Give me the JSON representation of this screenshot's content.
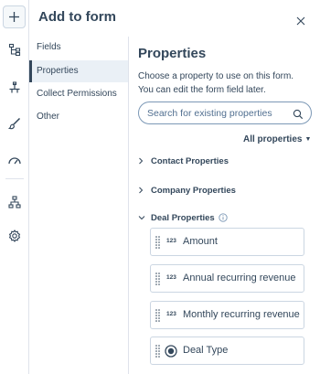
{
  "header": {
    "title": "Add to form"
  },
  "rail": {
    "icons": [
      "plus-icon",
      "tree-structure-icon",
      "adjust-icon",
      "brush-icon",
      "gauge-icon",
      "hierarchy-icon",
      "settings-icon"
    ]
  },
  "subnav": {
    "items": [
      {
        "label": "Fields",
        "active": false
      },
      {
        "label": "Properties",
        "active": true
      },
      {
        "label": "Collect Permissions",
        "active": false
      },
      {
        "label": "Other",
        "active": false
      }
    ]
  },
  "panel": {
    "title": "Properties",
    "description": "Choose a property to use on this form. You can edit the form field later.",
    "search_placeholder": "Search for existing properties",
    "filter_label": "All properties",
    "sections": [
      {
        "label": "Contact Properties",
        "expanded": false
      },
      {
        "label": "Company Properties",
        "expanded": false
      },
      {
        "label": "Deal Properties",
        "expanded": true
      }
    ],
    "properties": [
      {
        "type_badge": "123",
        "label": "Amount"
      },
      {
        "type_badge": "123",
        "label": "Annual recurring revenue"
      },
      {
        "type_badge": "123",
        "label": "Monthly recurring revenue"
      },
      {
        "type_badge": "radio",
        "label": "Deal Type"
      }
    ]
  },
  "colors": {
    "text": "#33475b",
    "border": "#cbd6e2",
    "active_bg": "#eaf0f6"
  }
}
